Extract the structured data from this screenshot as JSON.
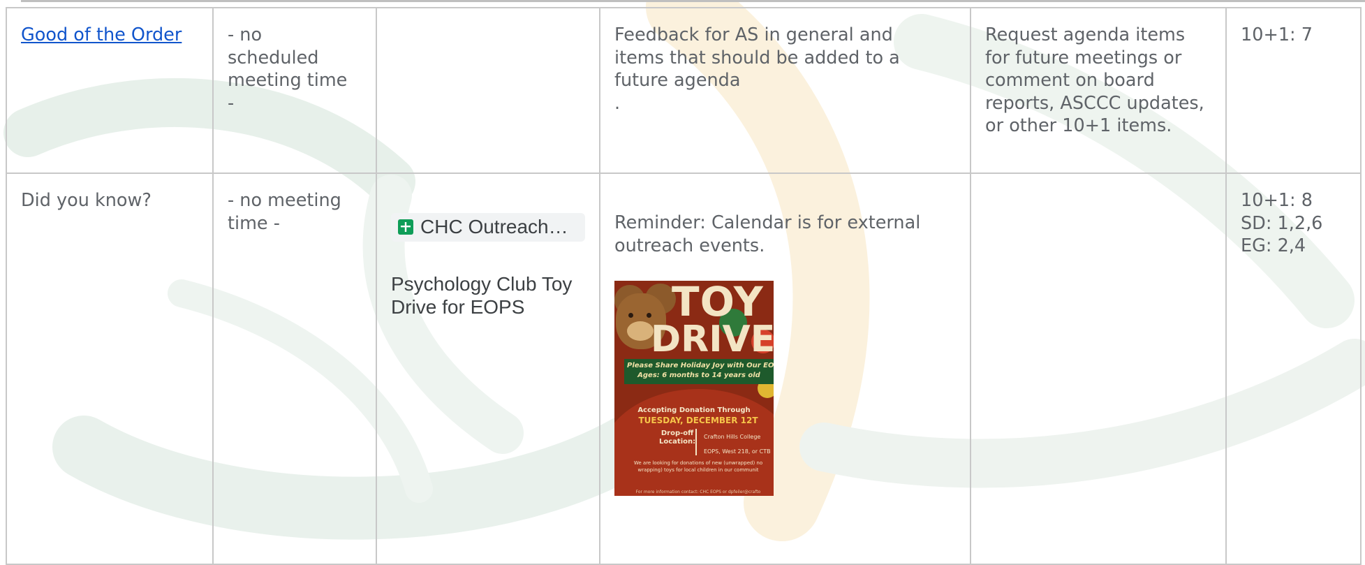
{
  "colors": {
    "text": "#5f6368",
    "link": "#1155cc",
    "border": "#c8c8c8",
    "chip_bg": "#f1f3f4",
    "sheets_icon": "#0f9d58",
    "poster_bg": "#8b2a14",
    "poster_banner": "#1e5a2c"
  },
  "rows": [
    {
      "topic": "Good of the Order",
      "time_lines": [
        "- no",
        "scheduled",
        "meeting time",
        "-"
      ],
      "documents": "",
      "purpose_lines": [
        "Feedback for AS in general and",
        "items that should be added to a",
        "future agenda",
        "."
      ],
      "outcome_lines": [
        "Request agenda items",
        "for future meetings or",
        "comment on board",
        "reports, ASCCC updates,",
        "or other 10+1 items."
      ],
      "alignment_lines": [
        "10+1: 7"
      ]
    },
    {
      "topic": "Did you know?",
      "time_lines": [
        "- no meeting",
        "time -"
      ],
      "documents": {
        "chip_icon": "google-sheets-icon",
        "chip_label": "CHC Outreach…",
        "event_title_lines": [
          "Psychology Club Toy",
          "Drive for EOPS"
        ]
      },
      "purpose_lines": [
        "Reminder: Calendar is for external",
        "outreach events."
      ],
      "poster": {
        "title_top": "TOY",
        "title_bottom": "DRIVE",
        "banner_lines": [
          "Please Share Holiday Joy with Our EOPS",
          "Ages: 6 months to 14 years old"
        ],
        "accepting": "Accepting Donation Through",
        "date": "TUESDAY, DECEMBER 12T",
        "dropoff_lines": [
          "Drop-off",
          "Location:"
        ],
        "location_lines": [
          "Crafton Hills College",
          "EOPS, West 218, or CTB"
        ],
        "fine_lines": [
          "We are looking for donations of new (unwrapped) no",
          "wrapping) toys for local children in our communit"
        ],
        "contact": "For more information contact: CHC EOPS or dpfeiler@crafto"
      },
      "outcome_lines": [],
      "alignment_lines": [
        "10+1: 8",
        "SD: 1,2,6",
        "EG: 2,4"
      ]
    }
  ]
}
